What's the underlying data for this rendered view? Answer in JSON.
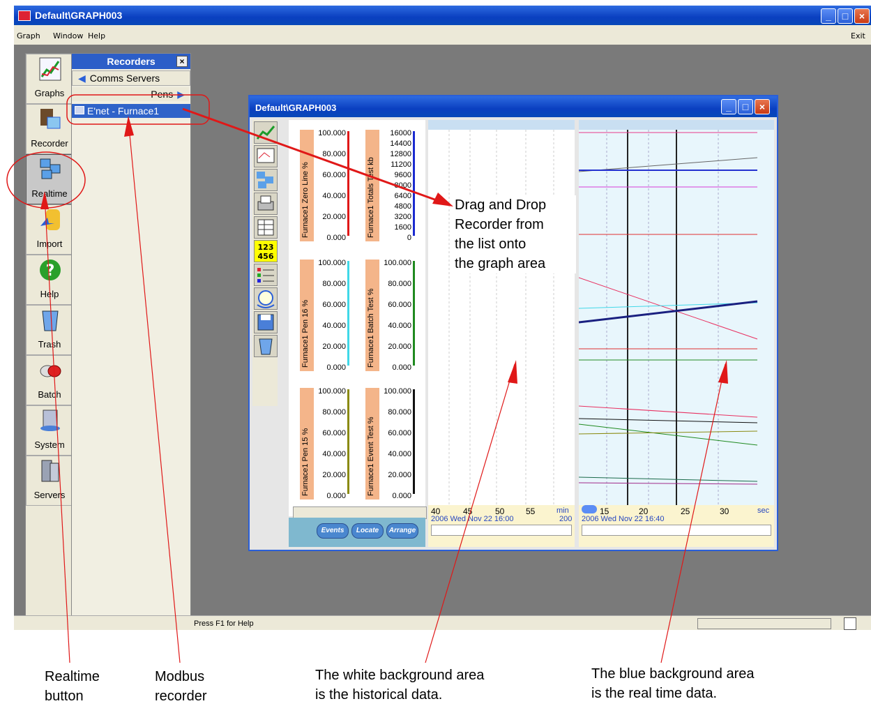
{
  "app": {
    "title": "Default\\GRAPH003"
  },
  "menu": {
    "items": [
      "Graph",
      "Window",
      "Help"
    ],
    "exit": "Exit"
  },
  "toolbar": [
    {
      "label": "Graphs",
      "icon": "graph-icon"
    },
    {
      "label": "Recorder",
      "icon": "recorder-icon"
    },
    {
      "label": "Realtime",
      "icon": "realtime-icon"
    },
    {
      "label": "Import",
      "icon": "import-icon"
    },
    {
      "label": "Help",
      "icon": "help-icon"
    },
    {
      "label": "Trash",
      "icon": "trash-icon"
    },
    {
      "label": "Batch",
      "icon": "batch-icon"
    },
    {
      "label": "System",
      "icon": "system-icon"
    },
    {
      "label": "Servers",
      "icon": "servers-icon"
    }
  ],
  "recorders": {
    "title": "Recorders",
    "comms": "Comms Servers",
    "pens": "Pens",
    "item": "E'net - Furnace1"
  },
  "status": {
    "text": "Press F1 for Help"
  },
  "child": {
    "title": "Default\\GRAPH003",
    "scales": [
      {
        "label": "Furnace1 Zero Line %",
        "ticks": [
          "100.000",
          "80.000",
          "60.000",
          "40.000",
          "20.000",
          "0.000"
        ],
        "color": "#e01818"
      },
      {
        "label": "Furnace1 Totals Test kb",
        "ticks": [
          "16000",
          "14400",
          "12800",
          "11200",
          "9600",
          "8000",
          "6400",
          "4800",
          "3200",
          "1600",
          "0"
        ],
        "color": "#1a2ad0"
      },
      {
        "label": "Furnace1 Pen 16 %",
        "ticks": [
          "100.000",
          "80.000",
          "60.000",
          "40.000",
          "20.000",
          "0.000"
        ],
        "color": "#40d8e8"
      },
      {
        "label": "Furnace1 Batch Test %",
        "ticks": [
          "100.000",
          "80.000",
          "60.000",
          "40.000",
          "20.000",
          "0.000"
        ],
        "color": "#1f8a1f"
      },
      {
        "label": "Furnace1 Pen 15 %",
        "ticks": [
          "100.000",
          "80.000",
          "60.000",
          "40.000",
          "20.000",
          "0.000"
        ],
        "color": "#8a8a10"
      },
      {
        "label": "Furnace1 Event Test %",
        "ticks": [
          "100.000",
          "80.000",
          "60.000",
          "40.000",
          "20.000",
          "0.000"
        ],
        "color": "#111111"
      }
    ],
    "buttons": [
      "Events",
      "Locate",
      "Arrange"
    ],
    "hist_axis": {
      "ticks": [
        "40",
        "45",
        "50",
        "55"
      ],
      "unit": "min",
      "date": "2006 Wed Nov 22  16:00",
      "extra": "200"
    },
    "rt_axis": {
      "ticks": [
        "15",
        "20",
        "25",
        "30"
      ],
      "unit": "sec",
      "date": "2006 Wed Nov 22  16:40"
    }
  },
  "annotations": {
    "drag": [
      "Drag and Drop",
      "Recorder from",
      "the list onto",
      "the graph area"
    ],
    "realtime": [
      "Realtime",
      "button"
    ],
    "modbus": [
      "Modbus",
      "recorder"
    ],
    "white": [
      "The white background area",
      "is the historical data."
    ],
    "blue": [
      "The blue background area",
      "is the real time data."
    ]
  }
}
